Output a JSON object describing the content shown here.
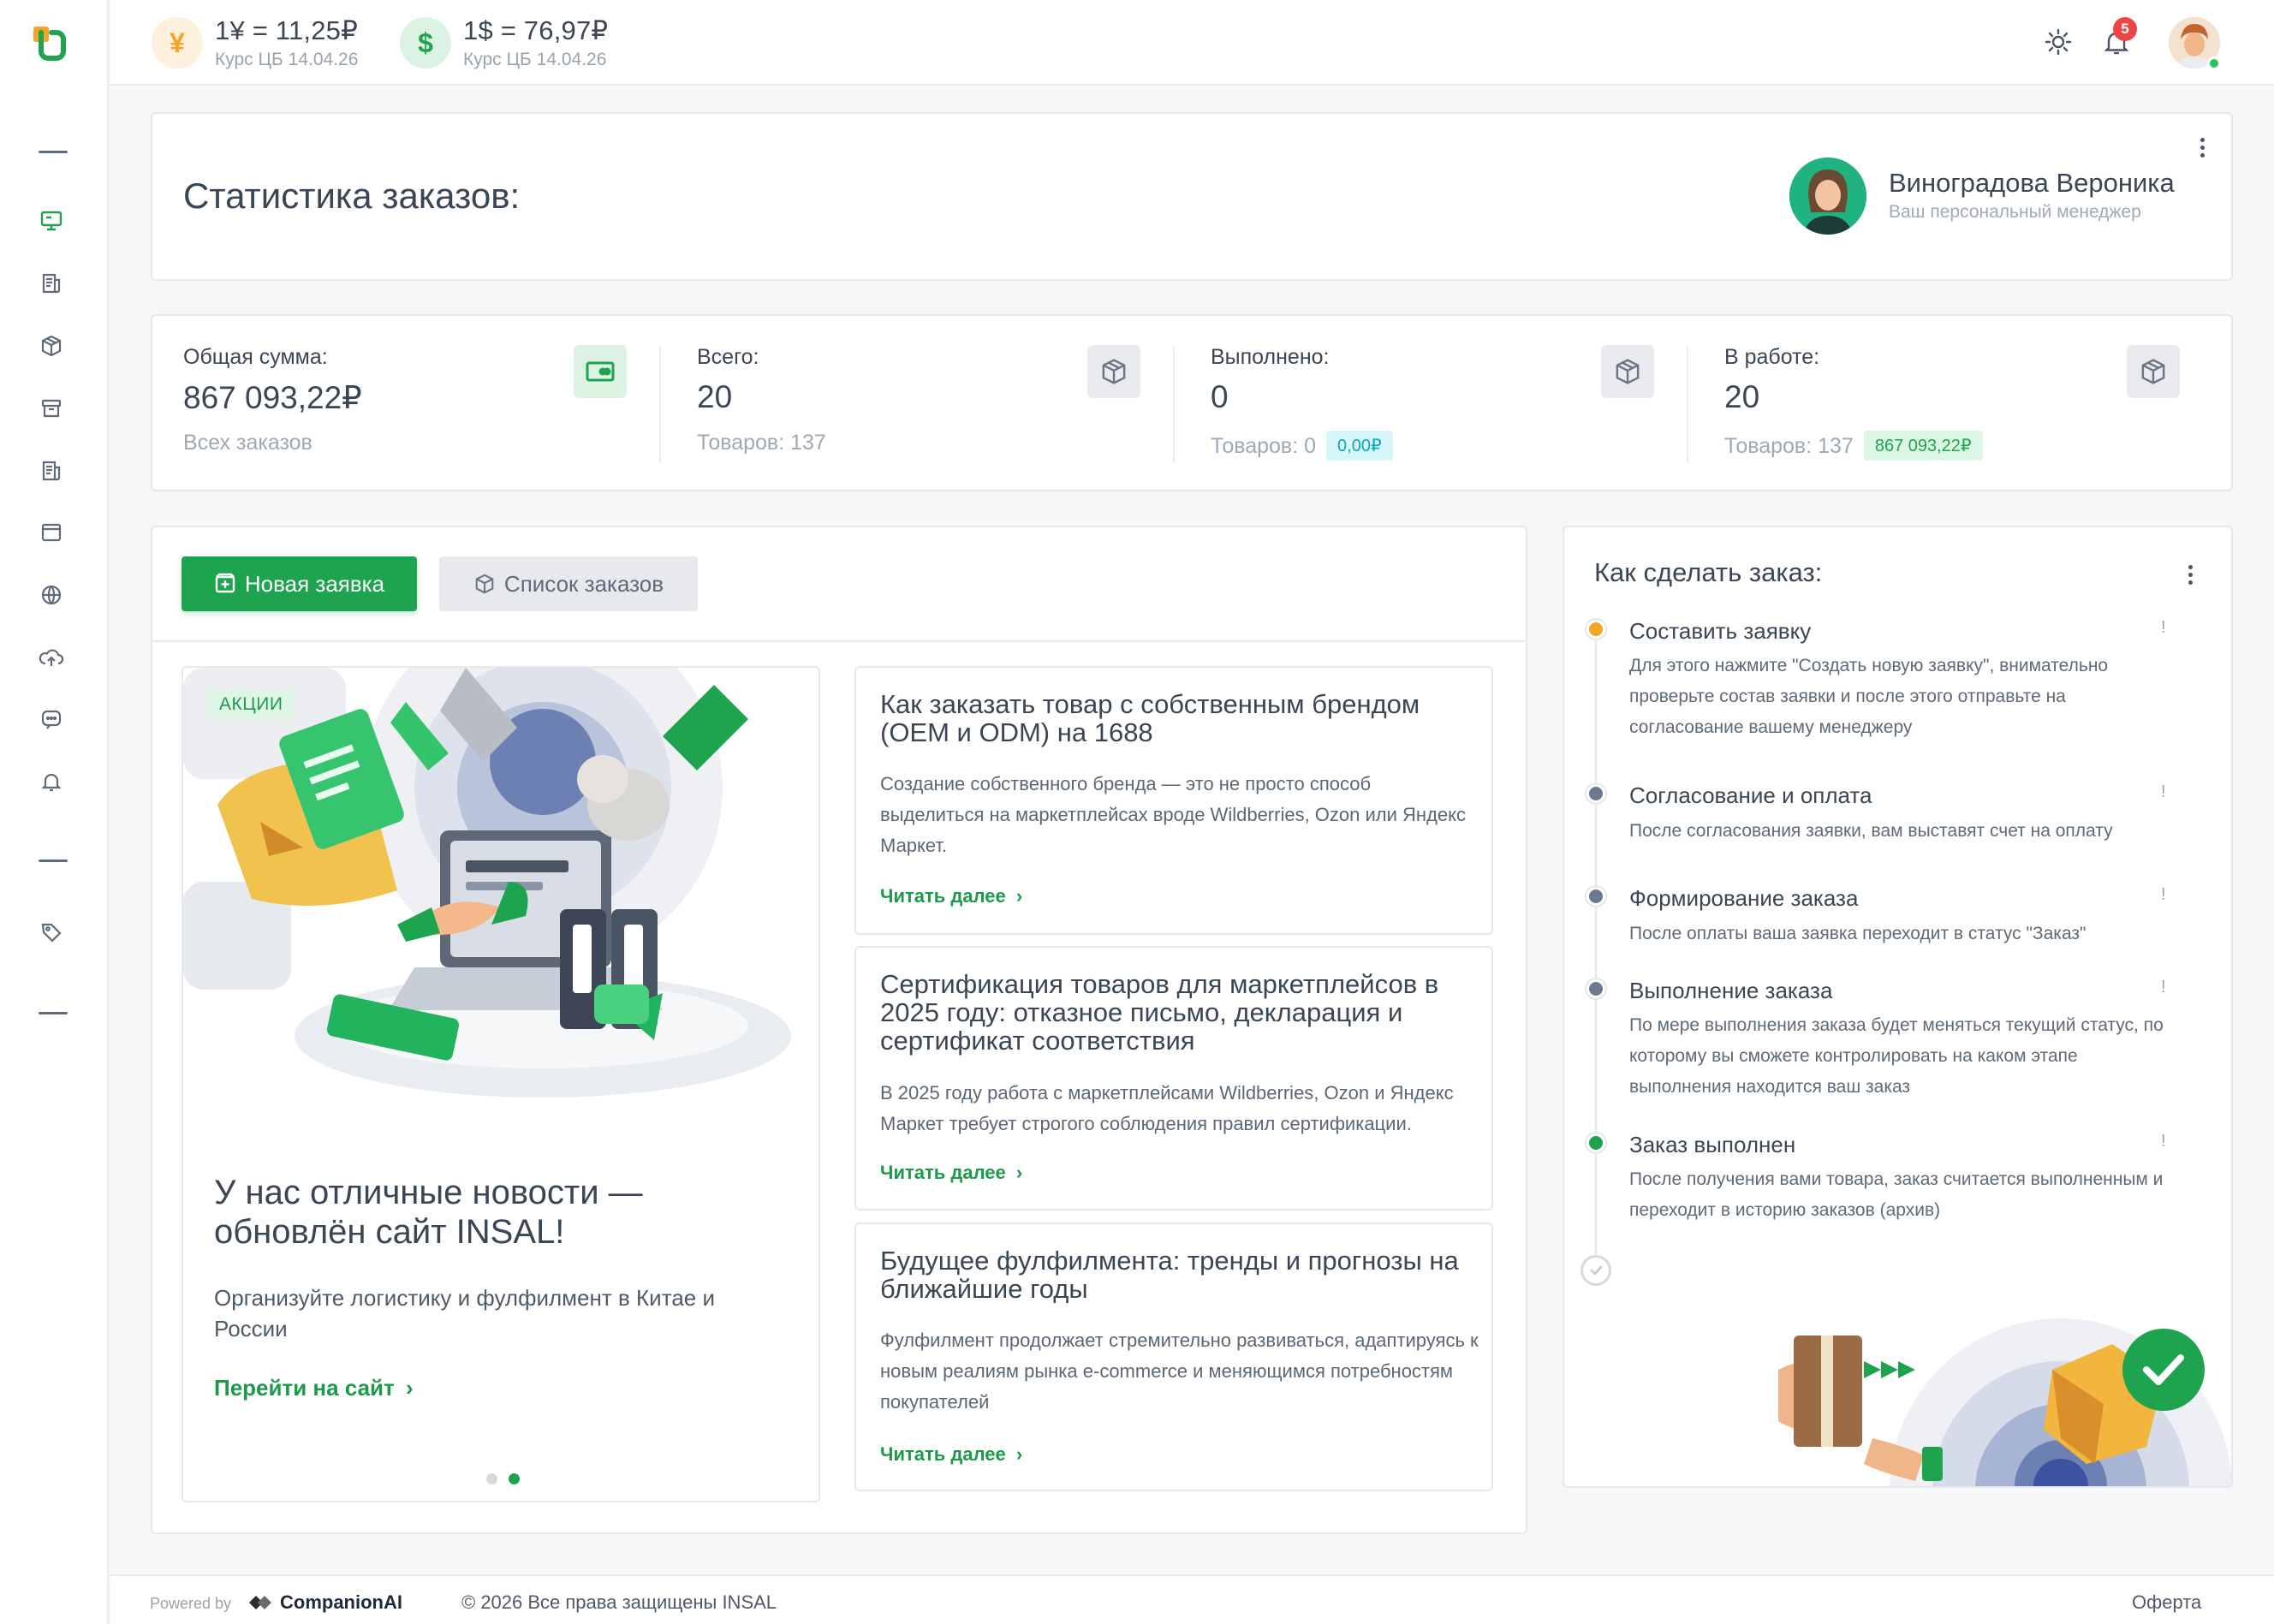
{
  "rates": [
    {
      "icon": "yuan-icon",
      "symbol": "¥",
      "value": "1¥ = 11,25₽",
      "subtitle": "Курс ЦБ 14.04.26",
      "color": "#f5a524",
      "bg": "#fdf0dc"
    },
    {
      "icon": "dollar-icon",
      "symbol": "$",
      "value": "1$ = 76,97₽",
      "subtitle": "Курс ЦБ 14.04.26",
      "color": "#1ea34e",
      "bg": "#dcf3e4"
    }
  ],
  "header": {
    "notifications_count": "5"
  },
  "stats_header": {
    "title": "Статистика заказов:",
    "manager_name": "Виноградова Вероника",
    "manager_role": "Ваш персональный менеджер"
  },
  "stats": [
    {
      "label": "Общая сумма:",
      "value": "867 093,22₽",
      "sub": "Всех заказов",
      "icon": "money-icon",
      "pill": ""
    },
    {
      "label": "Всего:",
      "value": "20",
      "sub": "Товаров: 137",
      "icon": "box-icon",
      "pill": ""
    },
    {
      "label": "Выполнено:",
      "value": "0",
      "sub": "Товаров: 0",
      "icon": "box-icon",
      "pill": "0,00₽"
    },
    {
      "label": "В работе:",
      "value": "20",
      "sub": "Товаров: 137",
      "icon": "box-icon",
      "pill": "867 093,22₽"
    }
  ],
  "buttons": {
    "new_request": "Новая заявка",
    "order_list": "Список заказов"
  },
  "promo": {
    "tag": "АКЦИИ",
    "title": "У нас отличные новости — обновлён сайт INSAL!",
    "text": "Организуйте логистику и фулфилмент в Китае и России",
    "link": "Перейти на сайт",
    "slides": 2,
    "active_slide": 2
  },
  "articles": [
    {
      "title": "Как заказать товар с собственным брендом (OEM и ODM) на 1688",
      "text": "Создание собственного бренда — это не просто способ выделиться на маркетплейсах вроде Wildberries, Ozon или Яндекс Маркет.",
      "link": "Читать далее"
    },
    {
      "title": "Сертификация товаров для маркетплейсов в 2025 году: отказное письмо, декларация и сертификат соответствия",
      "text": "В 2025 году работа с маркетплейсами Wildberries, Ozon и Яндекс Маркет требует строгого соблюдения правил сертификации.",
      "link": "Читать далее"
    },
    {
      "title": "Будущее фулфилмента: тренды и прогнозы на ближайшие годы",
      "text": "Фулфилмент продолжает стремительно развиваться, адаптируясь к новым реалиям рынка e-commerce и меняющимся потребностям покупателей",
      "link": "Читать далее"
    }
  ],
  "how_to": {
    "title": "Как сделать заказ:",
    "steps": [
      {
        "title": "Составить заявку",
        "text": "Для этого нажмите \"Создать новую заявку\", внимательно проверьте состав заявки и после этого отправьте на согласование вашему менеджеру",
        "color": "#f5a524"
      },
      {
        "title": "Согласование и оплата",
        "text": "После согласования заявки, вам выставят счет на оплату",
        "color": "#6b7a8f"
      },
      {
        "title": "Формирование заказа",
        "text": "После оплаты ваша заявка переходит в статус \"Заказ\"",
        "color": "#6b7a8f"
      },
      {
        "title": "Выполнение заказа",
        "text": "По мере выполнения заказа будет меняться текущий статус, по которому вы сможете контролировать на каком этапе выполнения находится ваш заказ",
        "color": "#6b7a8f"
      },
      {
        "title": "Заказ выполнен",
        "text": "После получения вами товара, заказ считается выполненным и переходит в историю заказов (архив)",
        "color": "#1ea34e"
      }
    ]
  },
  "footer": {
    "powered": "Powered by",
    "brand": "CompanionAI",
    "copyright": "© 2026 Все права защищены INSAL",
    "offer": "Оферта"
  },
  "colors": {
    "accent": "#1ea34e",
    "warning": "#f5a524",
    "danger": "#ef4444",
    "cyan_pill": "#0aa6b8"
  }
}
